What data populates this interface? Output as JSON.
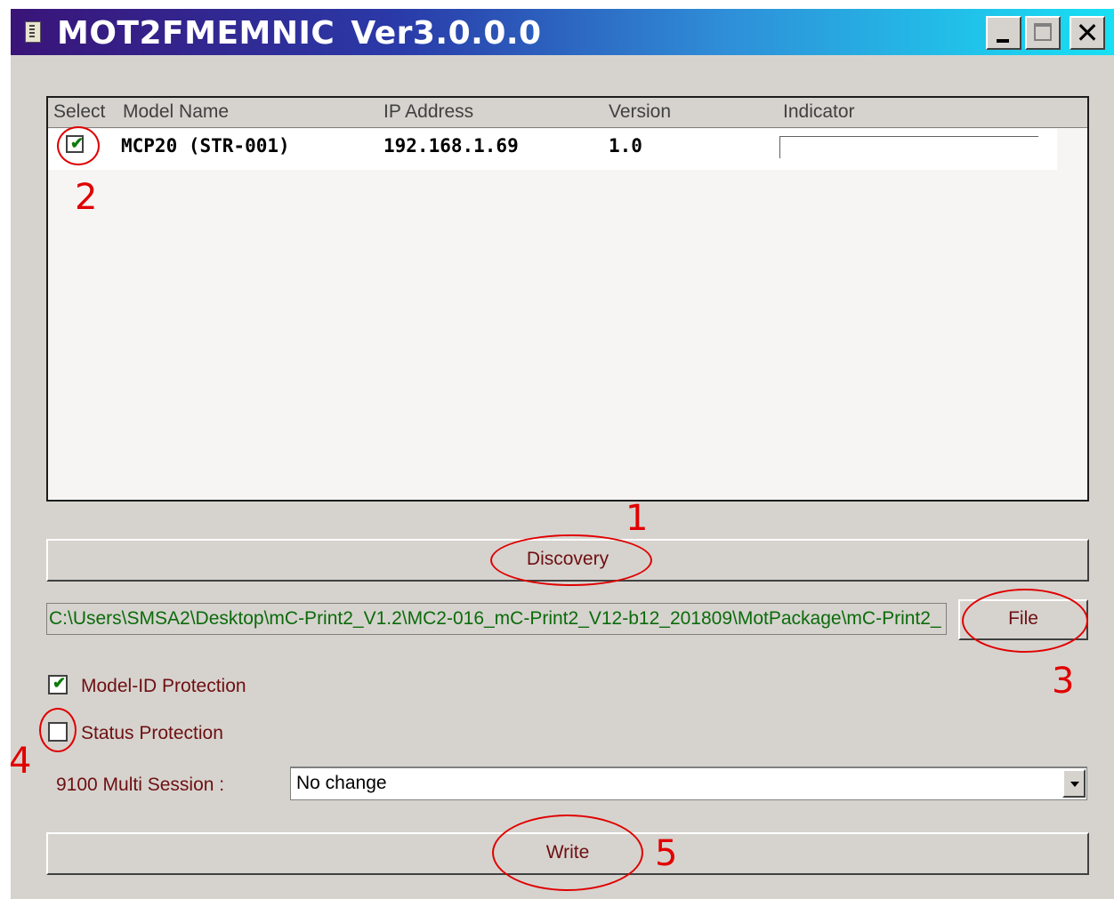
{
  "window": {
    "title": "MOT2FMEMNIC",
    "version": "Ver3.0.0.0",
    "controls": {
      "minimize": "minimize",
      "maximize": "maximize",
      "close": "✕"
    }
  },
  "device_list": {
    "columns": [
      "Select",
      "Model Name",
      "IP Address",
      "Version",
      "Indicator"
    ],
    "rows": [
      {
        "selected": true,
        "model_name": "MCP20 (STR-001)",
        "ip_address": "192.168.1.69",
        "version": "1.0",
        "indicator": ""
      }
    ]
  },
  "discovery_button": {
    "label": "Discovery"
  },
  "file_path": {
    "value": "C:\\Users\\SMSA2\\Desktop\\mC-Print2_V1.2\\MC2-016_mC-Print2_V12-b12_201809\\MotPackage\\mC-Print2_"
  },
  "file_button": {
    "label": "File"
  },
  "options": {
    "model_id_protection": {
      "label": "Model-ID Protection",
      "checked": true
    },
    "status_protection": {
      "label": "Status Protection",
      "checked": false
    },
    "multi_session": {
      "label": "9100 Multi Session :",
      "selected": "No change"
    }
  },
  "write_button": {
    "label": "Write"
  },
  "annotations": [
    "1",
    "2",
    "3",
    "4",
    "5"
  ],
  "colors": {
    "annotation": "#e00000",
    "label_text": "#6e0f12",
    "path_text": "#0b6b0b",
    "window_bg": "#d6d3ce"
  },
  "icons": [
    "app-icon",
    "checkmark-icon",
    "dropdown-arrow-icon"
  ]
}
